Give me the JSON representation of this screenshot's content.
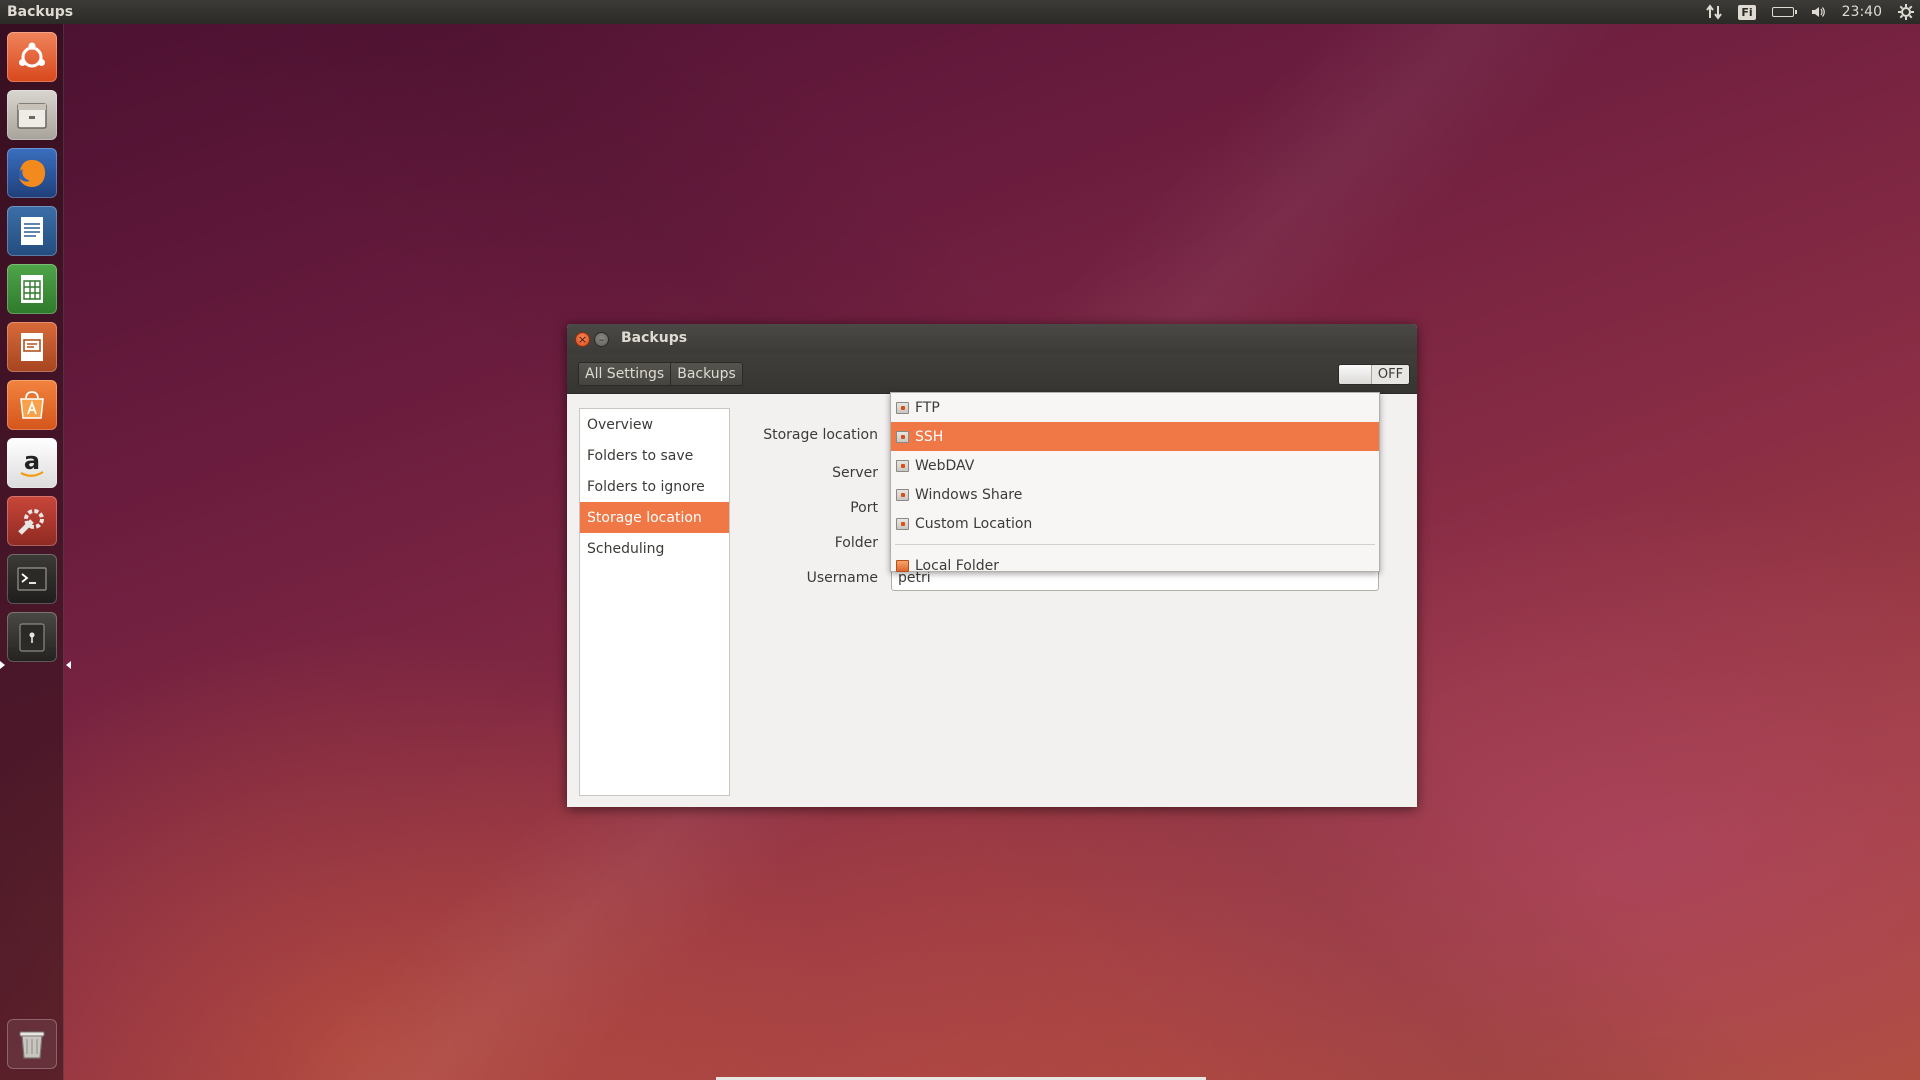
{
  "top_panel": {
    "app_title": "Backups",
    "keyboard_layout": "Fi",
    "clock": "23:40",
    "icons": [
      "network-icon",
      "keyboard-icon",
      "battery-icon",
      "volume-icon",
      "settings-gear-icon"
    ]
  },
  "launcher": {
    "items": [
      "ubuntu-dash-icon",
      "files-icon",
      "firefox-icon",
      "writer-icon",
      "calc-icon",
      "impress-icon",
      "software-center-icon",
      "amazon-icon",
      "system-settings-icon",
      "terminal-icon",
      "backups-icon",
      "trash-icon"
    ]
  },
  "window": {
    "title": "Backups",
    "breadcrumb": [
      "All Settings",
      "Backups"
    ],
    "switch_label": "OFF",
    "sidebar": [
      "Overview",
      "Folders to save",
      "Folders to ignore",
      "Storage location",
      "Scheduling"
    ],
    "sidebar_active": "Storage location",
    "form": {
      "storage_location_label": "Storage location",
      "server_label": "Server",
      "port_label": "Port",
      "folder_label": "Folder",
      "username_label": "Username",
      "username_value": "petri"
    }
  },
  "dropdown": {
    "items": [
      "FTP",
      "SSH",
      "WebDAV",
      "Windows Share",
      "Custom Location"
    ],
    "selected": "SSH",
    "local_item": "Local Folder"
  },
  "colors": {
    "accent": "#f07746",
    "panel": "#3c3b37",
    "window_bg": "#f2f1f0"
  }
}
